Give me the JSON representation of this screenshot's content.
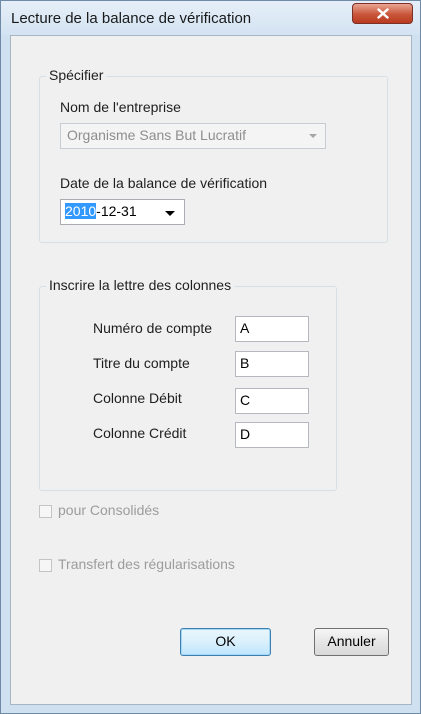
{
  "window": {
    "title": "Lecture de la balance de vérification",
    "close_glyph": "X"
  },
  "specify_group": {
    "label": "Spécifier",
    "company_label": "Nom de l'entreprise",
    "company_value": "Organisme Sans But Lucratif",
    "date_label": "Date de la balance de vérification",
    "date_year": "2010",
    "date_rest": "-12-31"
  },
  "columns_group": {
    "label": "Inscrire la lettre des colonnes",
    "rows": [
      {
        "label": "Numéro de compte",
        "value": "A"
      },
      {
        "label": "Titre du compte",
        "value": "B"
      },
      {
        "label": "Colonne Débit",
        "value": "C"
      },
      {
        "label": "Colonne Crédit",
        "value": "D"
      }
    ]
  },
  "options": {
    "consolidated_label": "pour Consolidés",
    "consolidated_checked": false,
    "transfer_label": "Transfert des régularisations",
    "transfer_checked": false
  },
  "buttons": {
    "ok_label": "OK",
    "cancel_label": "Annuler"
  },
  "colors": {
    "title_bar": "#dce8f5",
    "close_button": "#c9563a",
    "selection": "#3399ff",
    "default_button_border": "#3c7fb1"
  }
}
